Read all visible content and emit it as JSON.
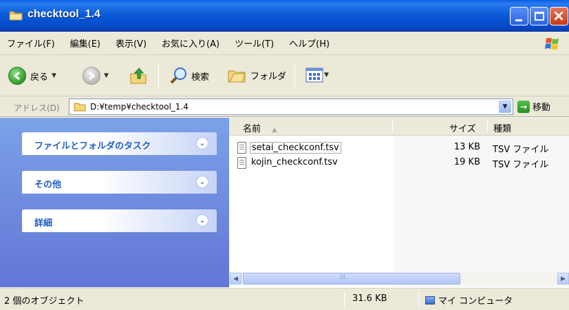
{
  "window": {
    "title": "checktool_1.4"
  },
  "menu": {
    "items": [
      "ファイル(F)",
      "編集(E)",
      "表示(V)",
      "お気に入り(A)",
      "ツール(T)",
      "ヘルプ(H)"
    ]
  },
  "toolbar": {
    "back_label": "戻る",
    "search_label": "検索",
    "folders_label": "フォルダ"
  },
  "address": {
    "label": "アドレス(D)",
    "path": "D:¥temp¥checktool_1.4",
    "go_label": "移動"
  },
  "taskpane": {
    "panels": [
      "ファイルとフォルダのタスク",
      "その他",
      "詳細"
    ]
  },
  "filelist": {
    "columns": {
      "name": "名前",
      "size": "サイズ",
      "type": "種類"
    },
    "rows": [
      {
        "name": "setai_checkconf.tsv",
        "size": "13 KB",
        "type": "TSV ファイル"
      },
      {
        "name": "kojin_checkconf.tsv",
        "size": "19 KB",
        "type": "TSV ファイル"
      }
    ],
    "scroll_thumb": "III"
  },
  "status": {
    "objects": "2 個のオブジェクト",
    "size": "31.6 KB",
    "location": "マイ コンピュータ"
  },
  "colors": {
    "titlebar": "#0b5cd8",
    "taskpane": "#6f8ce0",
    "task_label": "#215dc6"
  }
}
